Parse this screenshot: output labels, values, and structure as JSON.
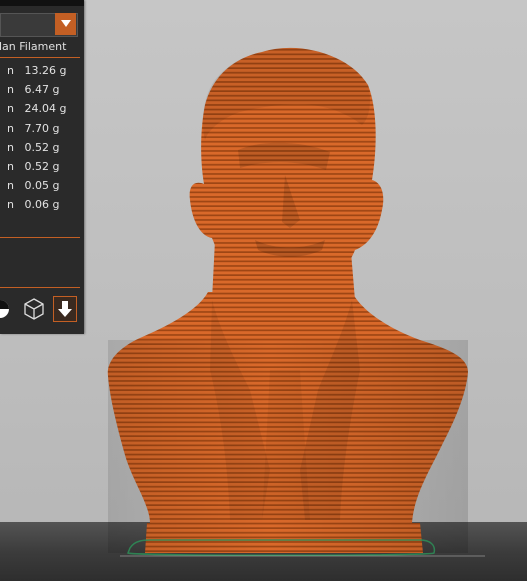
{
  "panel": {
    "material_header": "ulan Filament",
    "rows": [
      {
        "unit": "n",
        "value": "13.26 g"
      },
      {
        "unit": "n",
        "value": "6.47 g"
      },
      {
        "unit": "n",
        "value": "24.04 g"
      },
      {
        "unit": "n",
        "value": "7.70 g"
      },
      {
        "unit": "n",
        "value": "0.52 g"
      },
      {
        "unit": "n",
        "value": "0.52 g"
      },
      {
        "unit": "n",
        "value": "0.05 g"
      },
      {
        "unit": "n",
        "value": "0.06 g"
      }
    ],
    "combo_icon": "chevron-down-icon",
    "tools": [
      "contrast-icon",
      "wireframe-cube-icon",
      "download-arrow-icon"
    ]
  },
  "viewport": {
    "model": "sliced-bust",
    "model_color": "#d86a2c",
    "accent_color": "#c35f24",
    "outline_color": "#2e8b57"
  }
}
